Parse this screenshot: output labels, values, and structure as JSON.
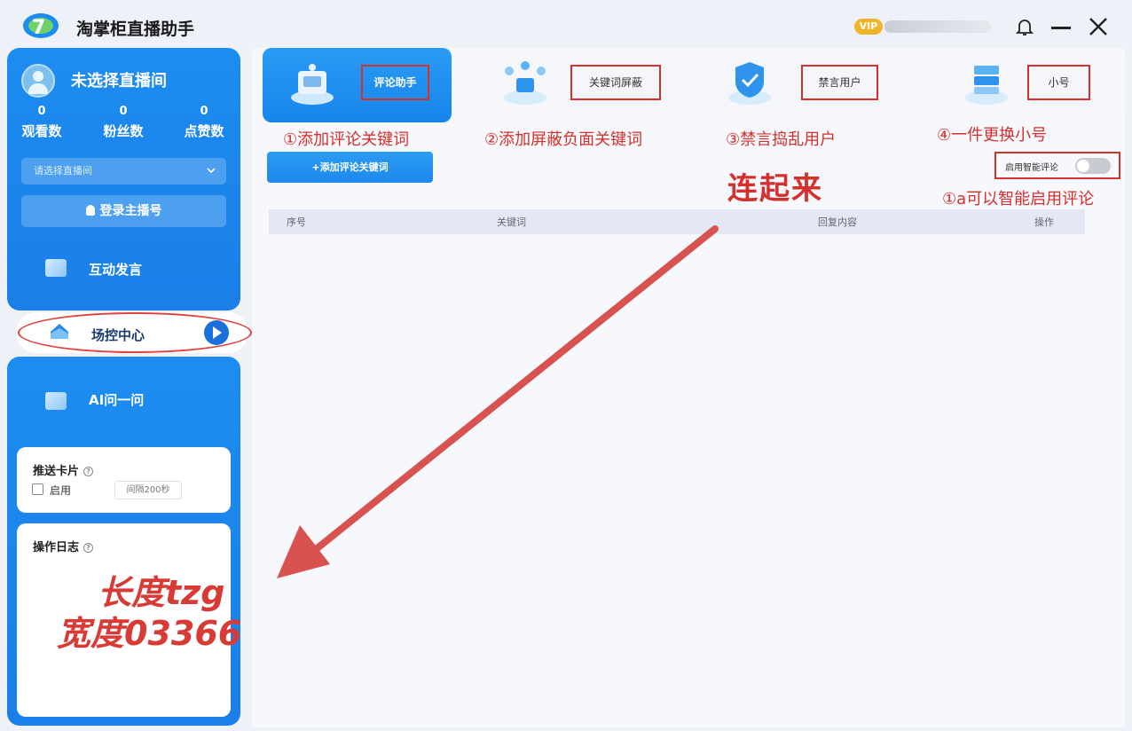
{
  "app": {
    "title": "淘掌柜直播助手",
    "vip_badge": "VIP"
  },
  "sidebar": {
    "room_name": "未选择直播间",
    "stats": [
      {
        "value": "0",
        "label": "观看数"
      },
      {
        "value": "0",
        "label": "粉丝数"
      },
      {
        "value": "0",
        "label": "点赞数"
      }
    ],
    "room_select_placeholder": "请选择直播间",
    "login_button": "登录主播号",
    "nav": [
      {
        "label": "互动发言"
      },
      {
        "label": "场控中心"
      },
      {
        "label": "AI问一问"
      }
    ],
    "push_card": {
      "title": "推送卡片",
      "enable_label": "启用",
      "interval": "间隔200秒"
    },
    "log_card": {
      "title": "操作日志"
    }
  },
  "tabs": [
    {
      "label": "评论助手",
      "annotation": "①添加评论关键词"
    },
    {
      "label": "关键词屏蔽",
      "annotation": "②添加屏蔽负面关键词"
    },
    {
      "label": "禁言用户",
      "annotation": "③禁言捣乱用户"
    },
    {
      "label": "小号",
      "annotation": "④一件更换小号"
    }
  ],
  "toolbar": {
    "add_button": "+添加评论关键词",
    "smart_toggle_label": "启用智能评论",
    "smart_annotation": "①a可以智能启用评论",
    "connect_annotation": "连起来"
  },
  "table": {
    "columns": [
      "序号",
      "关键词",
      "回复内容",
      "操作"
    ]
  },
  "watermark": {
    "line1": "长度tzg",
    "line2": "宽度03366"
  },
  "colors": {
    "primary": "#1d8cf0",
    "annotation_red": "#d4302d",
    "vip": "#f0b429"
  }
}
